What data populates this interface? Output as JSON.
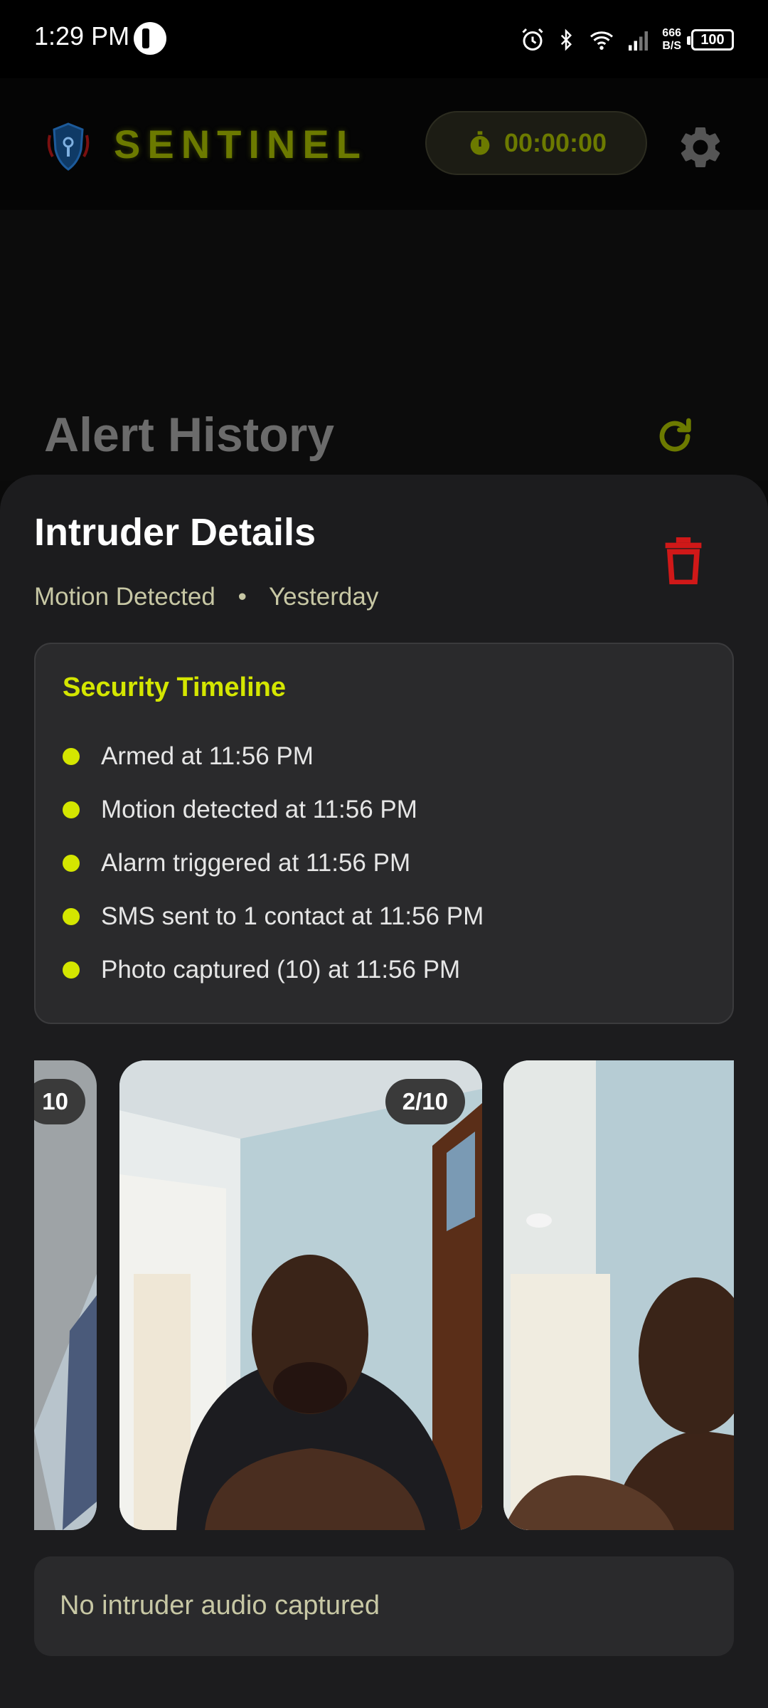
{
  "status_bar": {
    "time": "1:29 PM",
    "net_speed_value": "666",
    "net_speed_unit": "B/S",
    "battery": "100"
  },
  "header": {
    "brand": "SENTINEL",
    "timer": "00:00:00"
  },
  "page": {
    "title": "Alert History"
  },
  "sheet": {
    "title": "Intruder Details",
    "event_type": "Motion Detected",
    "separator": "•",
    "event_time": "Yesterday",
    "timeline": {
      "title": "Security Timeline",
      "items": [
        "Armed at 11:56 PM",
        "Motion detected at 11:56 PM",
        "Alarm triggered at 11:56 PM",
        "SMS sent to 1 contact at 11:56 PM",
        "Photo captured (10) at 11:56 PM"
      ]
    },
    "photos": [
      {
        "badge": "10"
      },
      {
        "badge": "2/10"
      },
      {
        "badge": ""
      }
    ],
    "audio_status": "No intruder audio captured"
  },
  "colors": {
    "accent": "#d4e600",
    "brand_dim": "#6c7a00",
    "danger": "#d01818",
    "sheet_bg": "#1c1c1e"
  }
}
